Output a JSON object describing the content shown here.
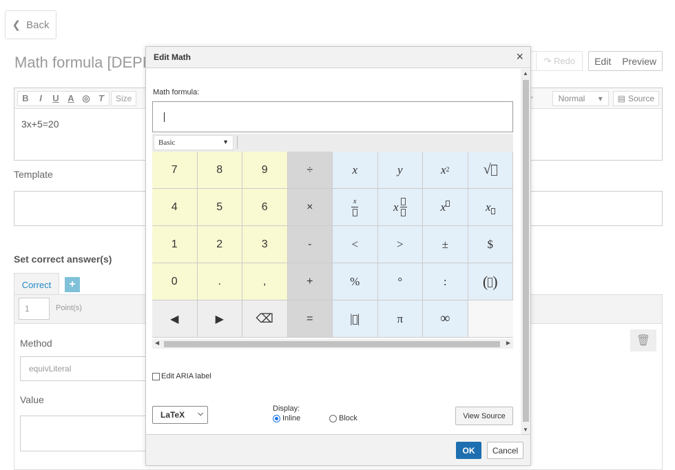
{
  "page": {
    "back_label": "Back",
    "title": "Math formula [DEPR",
    "undo_label": "",
    "redo_label": "Redo",
    "edit_label": "Edit",
    "preview_label": "Preview"
  },
  "editor": {
    "size_label": "Size",
    "format_value": "Normal",
    "source_label": "Source",
    "content": "3x+5=20"
  },
  "template_label": "Template",
  "answers": {
    "section_title": "Set correct answer(s)",
    "tab_label": "Correct",
    "add_label": "+",
    "points_value": "1",
    "points_label": "Point(s)",
    "method_label": "Method",
    "method_value": "equivLiteral",
    "value_label": "Value"
  },
  "dialog": {
    "title": "Edit Math",
    "close": "×",
    "formula_label": "Math formula:",
    "palette_value": "Basic",
    "aria_label": "Edit ARIA label",
    "format_value": "LaTeX",
    "display_label": "Display:",
    "inline_label": "Inline",
    "block_label": "Block",
    "view_source": "View Source",
    "ok": "OK",
    "cancel": "Cancel"
  },
  "keys": {
    "k7": "7",
    "k8": "8",
    "k9": "9",
    "div": "÷",
    "x": "x",
    "y": "y",
    "x2": "x",
    "sup2": "2",
    "k4": "4",
    "k5": "5",
    "k6": "6",
    "times": "×",
    "k1": "1",
    "k2": "2",
    "k3": "3",
    "minus": "-",
    "lt": "<",
    "gt": ">",
    "pm": "±",
    "dollar": "$",
    "k0": "0",
    "dot": ".",
    "comma": ",",
    "plus": "+",
    "percent": "%",
    "degree": "°",
    "colon": ":",
    "eq": "=",
    "pi": "π",
    "inf": "∞"
  }
}
